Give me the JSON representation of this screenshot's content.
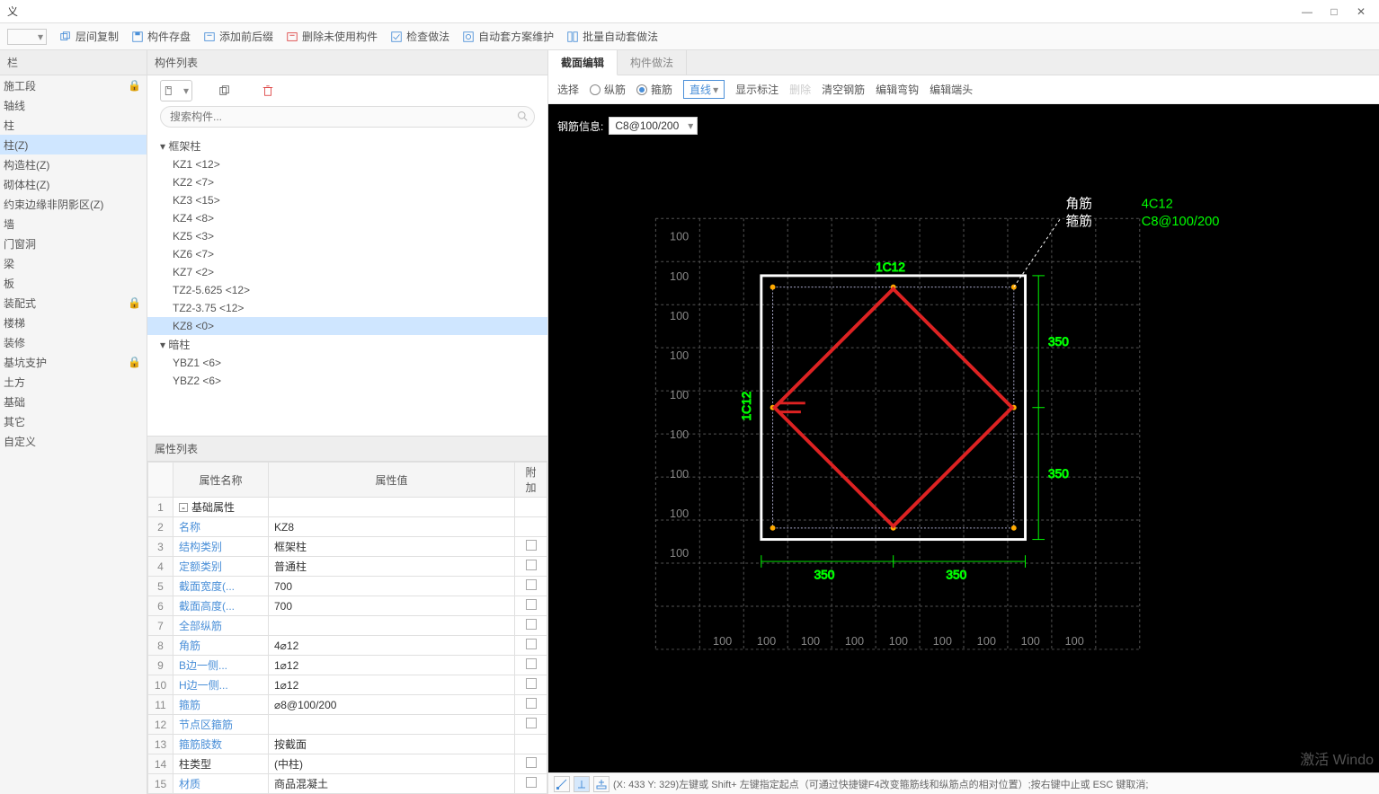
{
  "window": {
    "title": "义"
  },
  "toolbar": {
    "items": [
      "层间复制",
      "构件存盘",
      "添加前后缀",
      "删除未使用构件",
      "检查做法",
      "自动套方案维护",
      "批量自动套做法"
    ]
  },
  "left_nav": {
    "header": "栏",
    "items": [
      {
        "label": "施工段",
        "lock": true
      },
      {
        "label": "轴线",
        "lock": false
      },
      {
        "label": "柱",
        "lock": false
      },
      {
        "label": "柱(Z)",
        "lock": false,
        "selected": true
      },
      {
        "label": "构造柱(Z)",
        "lock": false
      },
      {
        "label": "砌体柱(Z)",
        "lock": false
      },
      {
        "label": "约束边缘非阴影区(Z)",
        "lock": false
      },
      {
        "label": "墙",
        "lock": false
      },
      {
        "label": "门窗洞",
        "lock": false
      },
      {
        "label": "梁",
        "lock": false
      },
      {
        "label": "板",
        "lock": false
      },
      {
        "label": "装配式",
        "lock": true
      },
      {
        "label": "楼梯",
        "lock": false
      },
      {
        "label": "装修",
        "lock": false
      },
      {
        "label": "基坑支护",
        "lock": true
      },
      {
        "label": "土方",
        "lock": false
      },
      {
        "label": "基础",
        "lock": false
      },
      {
        "label": "其它",
        "lock": false
      },
      {
        "label": "自定义",
        "lock": false
      }
    ]
  },
  "mid": {
    "header": "构件列表",
    "search_placeholder": "搜索构件...",
    "tree": [
      {
        "type": "group",
        "label": "框架柱"
      },
      {
        "type": "item",
        "label": "KZ1 <12>"
      },
      {
        "type": "item",
        "label": "KZ2 <7>"
      },
      {
        "type": "item",
        "label": "KZ3 <15>"
      },
      {
        "type": "item",
        "label": "KZ4 <8>"
      },
      {
        "type": "item",
        "label": "KZ5 <3>"
      },
      {
        "type": "item",
        "label": "KZ6 <7>"
      },
      {
        "type": "item",
        "label": "KZ7 <2>"
      },
      {
        "type": "item",
        "label": "TZ2-5.625 <12>"
      },
      {
        "type": "item",
        "label": "TZ2-3.75 <12>"
      },
      {
        "type": "item",
        "label": "KZ8 <0>",
        "selected": true
      },
      {
        "type": "group",
        "label": "暗柱"
      },
      {
        "type": "item",
        "label": "YBZ1 <6>"
      },
      {
        "type": "item",
        "label": "YBZ2 <6>"
      }
    ],
    "prop_header": "属性列表",
    "prop_cols": {
      "name": "属性名称",
      "value": "属性值",
      "addl": "附加"
    },
    "props": [
      {
        "n": "1",
        "name": "基础属性",
        "value": "",
        "link": false,
        "group": true
      },
      {
        "n": "2",
        "name": "名称",
        "value": "KZ8",
        "link": true
      },
      {
        "n": "3",
        "name": "结构类别",
        "value": "框架柱",
        "link": true,
        "chk": true
      },
      {
        "n": "4",
        "name": "定额类别",
        "value": "普通柱",
        "link": true,
        "chk": true
      },
      {
        "n": "5",
        "name": "截面宽度(...",
        "value": "700",
        "link": true,
        "chk": true
      },
      {
        "n": "6",
        "name": "截面高度(...",
        "value": "700",
        "link": true,
        "chk": true
      },
      {
        "n": "7",
        "name": "全部纵筋",
        "value": "",
        "link": true,
        "chk": true
      },
      {
        "n": "8",
        "name": "角筋",
        "value": "4⌀12",
        "link": true,
        "chk": true
      },
      {
        "n": "9",
        "name": "B边一侧...",
        "value": "1⌀12",
        "link": true,
        "chk": true
      },
      {
        "n": "10",
        "name": "H边一侧...",
        "value": "1⌀12",
        "link": true,
        "chk": true
      },
      {
        "n": "11",
        "name": "箍筋",
        "value": "⌀8@100/200",
        "link": true,
        "chk": true
      },
      {
        "n": "12",
        "name": "节点区箍筋",
        "value": "",
        "link": true,
        "chk": true
      },
      {
        "n": "13",
        "name": "箍筋肢数",
        "value": "按截面",
        "link": true
      },
      {
        "n": "14",
        "name": "柱类型",
        "value": "(中柱)",
        "link": false,
        "chk": true
      },
      {
        "n": "15",
        "name": "材质",
        "value": "商品混凝土",
        "link": true,
        "chk": true
      }
    ]
  },
  "right": {
    "tabs": [
      {
        "label": "截面编辑",
        "active": true
      },
      {
        "label": "构件做法"
      }
    ],
    "subbar": {
      "select_label": "选择",
      "radio1": "纵筋",
      "radio2": "箍筋",
      "radio2_checked": true,
      "straight": "直线",
      "btns": [
        "显示标注",
        "删除",
        "清空钢筋",
        "编辑弯钩",
        "编辑端头"
      ]
    },
    "info_label": "钢筋信息:",
    "info_value": "C8@100/200",
    "canvas_labels": {
      "corner1": "角筋",
      "corner2": "箍筋",
      "spec1": "4C12",
      "spec2": "C8@100/200",
      "top": "1C12",
      "left": "1C12",
      "dim350": "350",
      "dim100": "100"
    },
    "status": "(X: 433 Y: 329)左键或 Shift+ 左键指定起点（可通过快捷键F4改变箍筋线和纵筋点的相对位置）;按右键中止或 ESC 键取消;",
    "watermark": "激活 Windo"
  }
}
